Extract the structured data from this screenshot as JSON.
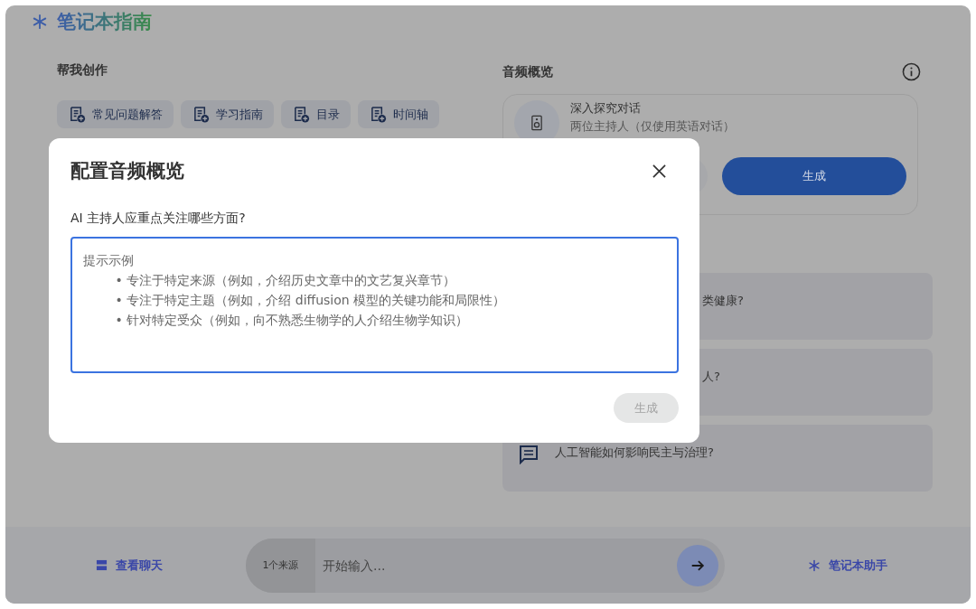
{
  "header": {
    "title": "笔记本指南"
  },
  "create": {
    "heading": "帮我创作",
    "chips": [
      {
        "label": "常见问题解答"
      },
      {
        "label": "学习指南"
      },
      {
        "label": "目录"
      },
      {
        "label": "时间轴"
      }
    ]
  },
  "audio": {
    "heading": "音频概览",
    "card": {
      "title": "深入探究对话",
      "subtitle": "两位主持人（仅使用英语对话）",
      "generate": "生成"
    }
  },
  "questions": [
    {
      "text": "类健康?",
      "covered": true
    },
    {
      "text": "人?",
      "covered": true
    },
    {
      "text": "人工智能如何影响民主与治理?",
      "covered": false
    }
  ],
  "bottom": {
    "chat": "查看聊天",
    "sources": "1个来源",
    "input_placeholder": "开始输入...",
    "assistant": "笔记本助手"
  },
  "dialog": {
    "title": "配置音频概览",
    "label": "AI 主持人应重点关注哪些方面?",
    "placeholder": "提示示例\n        • 专注于特定来源（例如，介绍历史文章中的文艺复兴章节）\n        • 专注于特定主题（例如，介绍 diffusion 模型的关键功能和局限性）\n        • 针对特定受众（例如，向不熟悉生物学的人介绍生物学知识）",
    "generate": "生成",
    "generate_disabled": true
  }
}
